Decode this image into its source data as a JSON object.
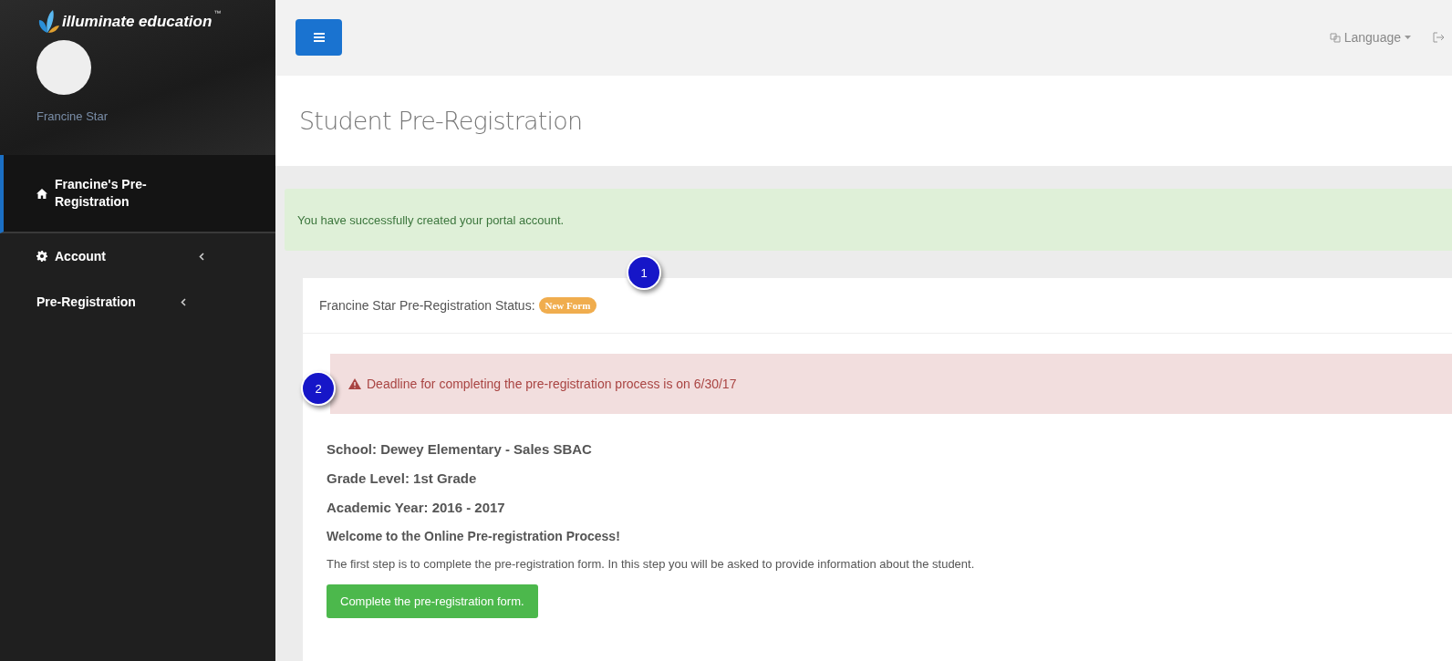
{
  "sidebar": {
    "logo_text": "illuminate education",
    "trademark": "™",
    "user_name": "Francine Star",
    "items": [
      {
        "label": "Francine's Pre-Registration",
        "kind": "home",
        "selected": true,
        "has_submenu": false
      },
      {
        "label": "Account",
        "kind": "gear",
        "selected": false,
        "has_submenu": true
      },
      {
        "label": "Pre-Registration",
        "kind": "none",
        "selected": false,
        "has_submenu": true
      }
    ]
  },
  "top_bar": {
    "language": "Language"
  },
  "page_title": "Student Pre-Registration",
  "success_alert": "You have successfully created your portal account.",
  "status": {
    "label": "Francine Star Pre-Registration Status:",
    "badge": "New Form"
  },
  "deadline_alert": "Deadline for completing the pre-registration process is on 6/30/17",
  "details": [
    "School: Dewey Elementary - Sales SBAC",
    "Grade Level: 1st Grade",
    "Academic Year: 2016 - 2017",
    "Welcome to the Online Pre-registration Process!"
  ],
  "instructions": "The first step is to complete the pre-registration form. In this step you will be asked to provide information about the student.",
  "action_button": "Complete the pre-registration form.",
  "callouts": [
    "1",
    "2"
  ]
}
